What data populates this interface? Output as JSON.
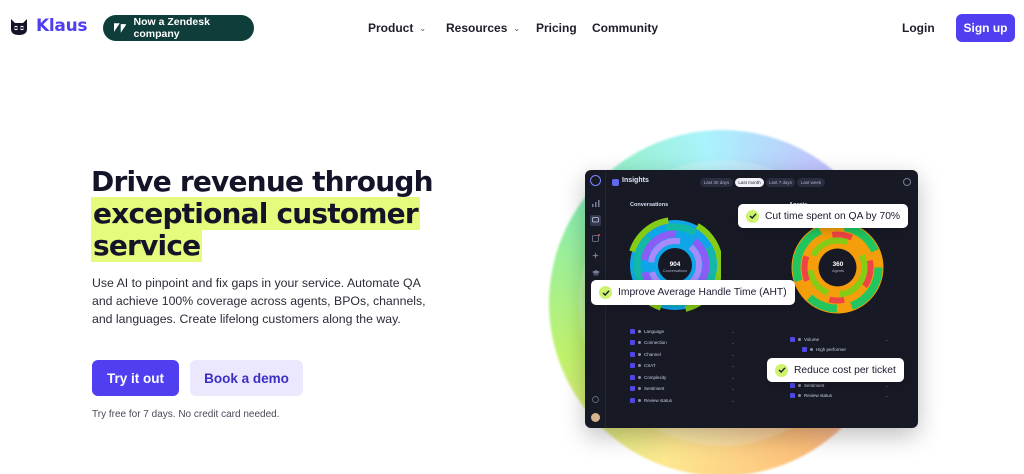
{
  "nav": {
    "logo_text": "Klaus",
    "zendesk_pill": "Now a Zendesk company",
    "items": [
      {
        "label": "Product",
        "has_dropdown": true
      },
      {
        "label": "Resources",
        "has_dropdown": true
      },
      {
        "label": "Pricing",
        "has_dropdown": false
      },
      {
        "label": "Community",
        "has_dropdown": false
      }
    ],
    "login": "Login",
    "signup": "Sign up",
    "chevron_icon": "chevron-down-icon"
  },
  "hero": {
    "title_line1": "Drive revenue through",
    "title_line2": "exceptional customer",
    "title_line3": "service",
    "subtitle": "Use AI to pinpoint and fix gaps in your service. Automate QA and achieve 100% coverage across agents, BPOs, channels, and languages. Create lifelong customers along the way.",
    "cta_primary": "Try it out",
    "cta_secondary": "Book a demo",
    "note": "Try free for 7 days. No credit card needed.",
    "highlight_color": "#e4fb7e",
    "brand_color": "#4f3ff0"
  },
  "dashboard": {
    "title": "Insights",
    "filters": [
      "Last 30 days",
      "Last month",
      "Last 7 days",
      "Last week"
    ],
    "active_filter": "Last month",
    "left_section": "Conversations",
    "right_section": "Agents",
    "left_center_value": "904",
    "left_center_label": "Conversations",
    "right_center_value": "360",
    "right_center_label": "Agents",
    "left_legend": [
      "Language",
      "Connection",
      "Channel",
      "CSAT",
      "Complexity",
      "Sentiment",
      "Review status"
    ],
    "right_legend": [
      "Volume",
      "High performer",
      "Sentiment",
      "Review status"
    ],
    "callouts": {
      "top": "Cut time spent on QA by 70%",
      "middle": "Improve Average Handle Time (AHT)",
      "bottom": "Reduce cost per ticket"
    }
  }
}
